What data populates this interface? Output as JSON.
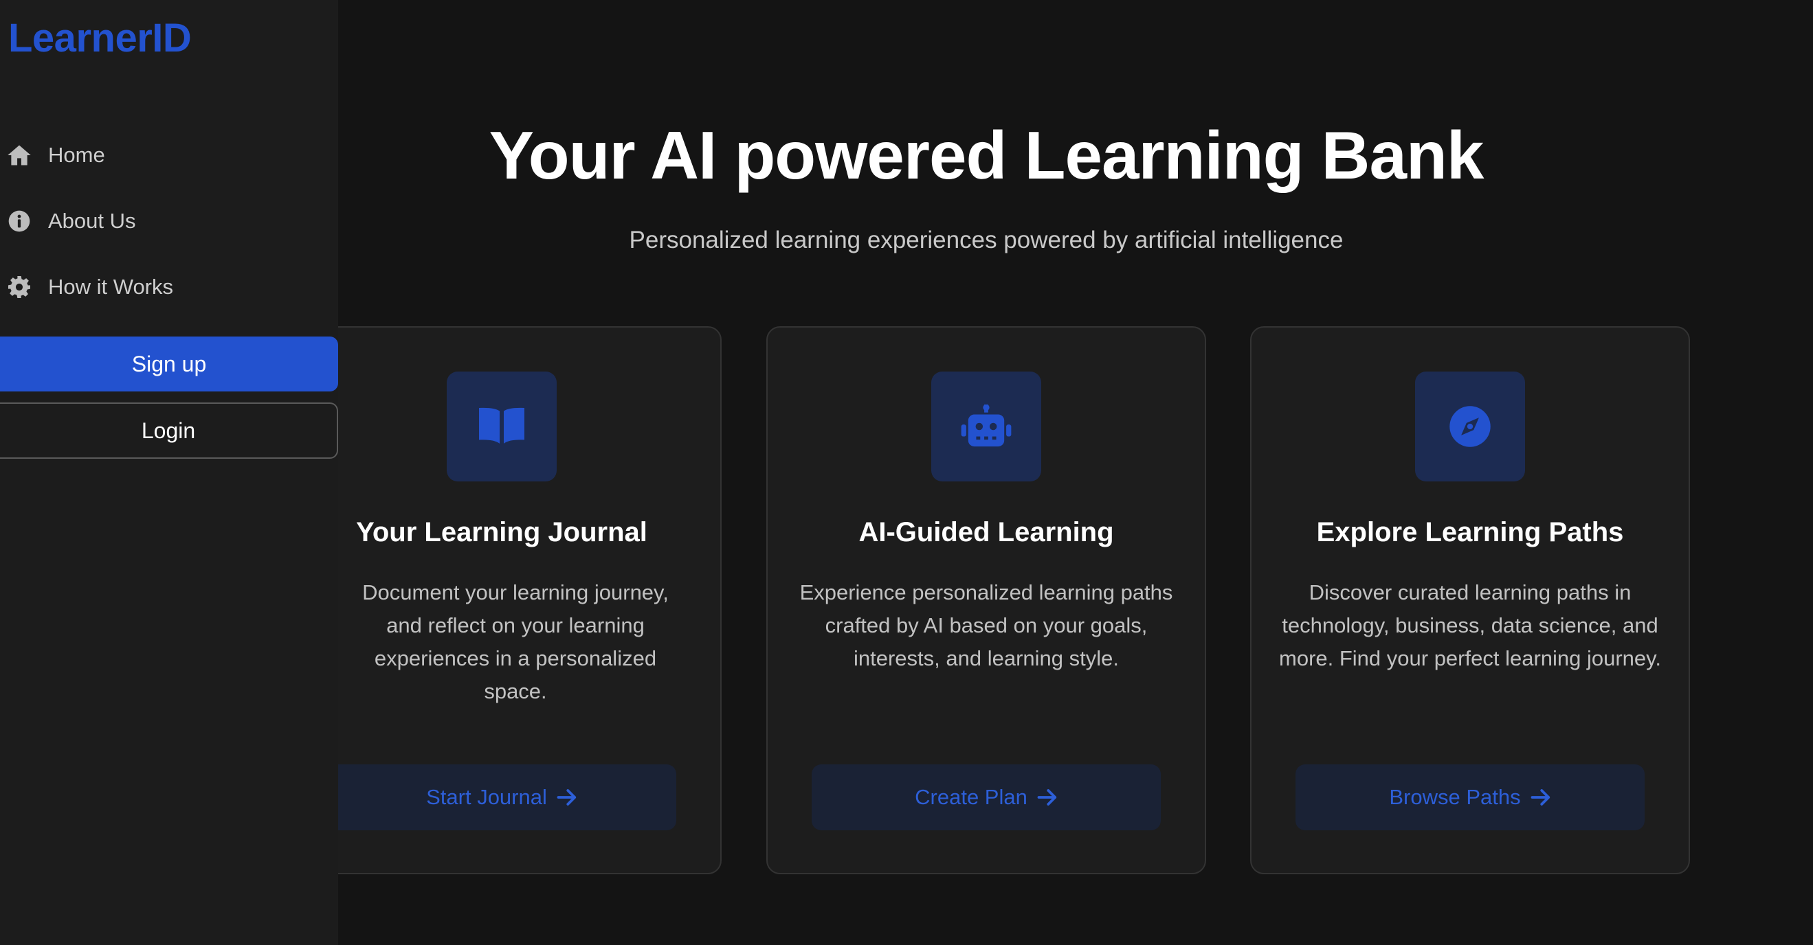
{
  "brand": "LearnerID",
  "nav": [
    {
      "label": "Home",
      "icon": "home-icon"
    },
    {
      "label": "About Us",
      "icon": "info-icon"
    },
    {
      "label": "How it Works",
      "icon": "gear-icon"
    }
  ],
  "auth": {
    "signup_label": "Sign up",
    "login_label": "Login"
  },
  "hero": {
    "title": "Your AI powered Learning Bank",
    "subtitle": "Personalized learning experiences powered by artificial intelligence"
  },
  "cards": [
    {
      "icon": "book-icon",
      "title": "Your Learning Journal",
      "description": "Document your learning journey, and reflect on your learning experiences in a personalized space.",
      "cta": "Start Journal"
    },
    {
      "icon": "robot-icon",
      "title": "AI-Guided Learning",
      "description": "Experience personalized learning paths crafted by AI based on your goals, interests, and learning style.",
      "cta": "Create Plan"
    },
    {
      "icon": "compass-icon",
      "title": "Explore Learning Paths",
      "description": "Discover curated learning paths in technology, business, data science, and more. Find your perfect learning journey.",
      "cta": "Browse Paths"
    }
  ],
  "colors": {
    "accent": "#2352cf",
    "background": "#141414",
    "sidebar": "#1c1c1c",
    "card": "#1d1d1d",
    "icon_box": "#1c2b52"
  }
}
